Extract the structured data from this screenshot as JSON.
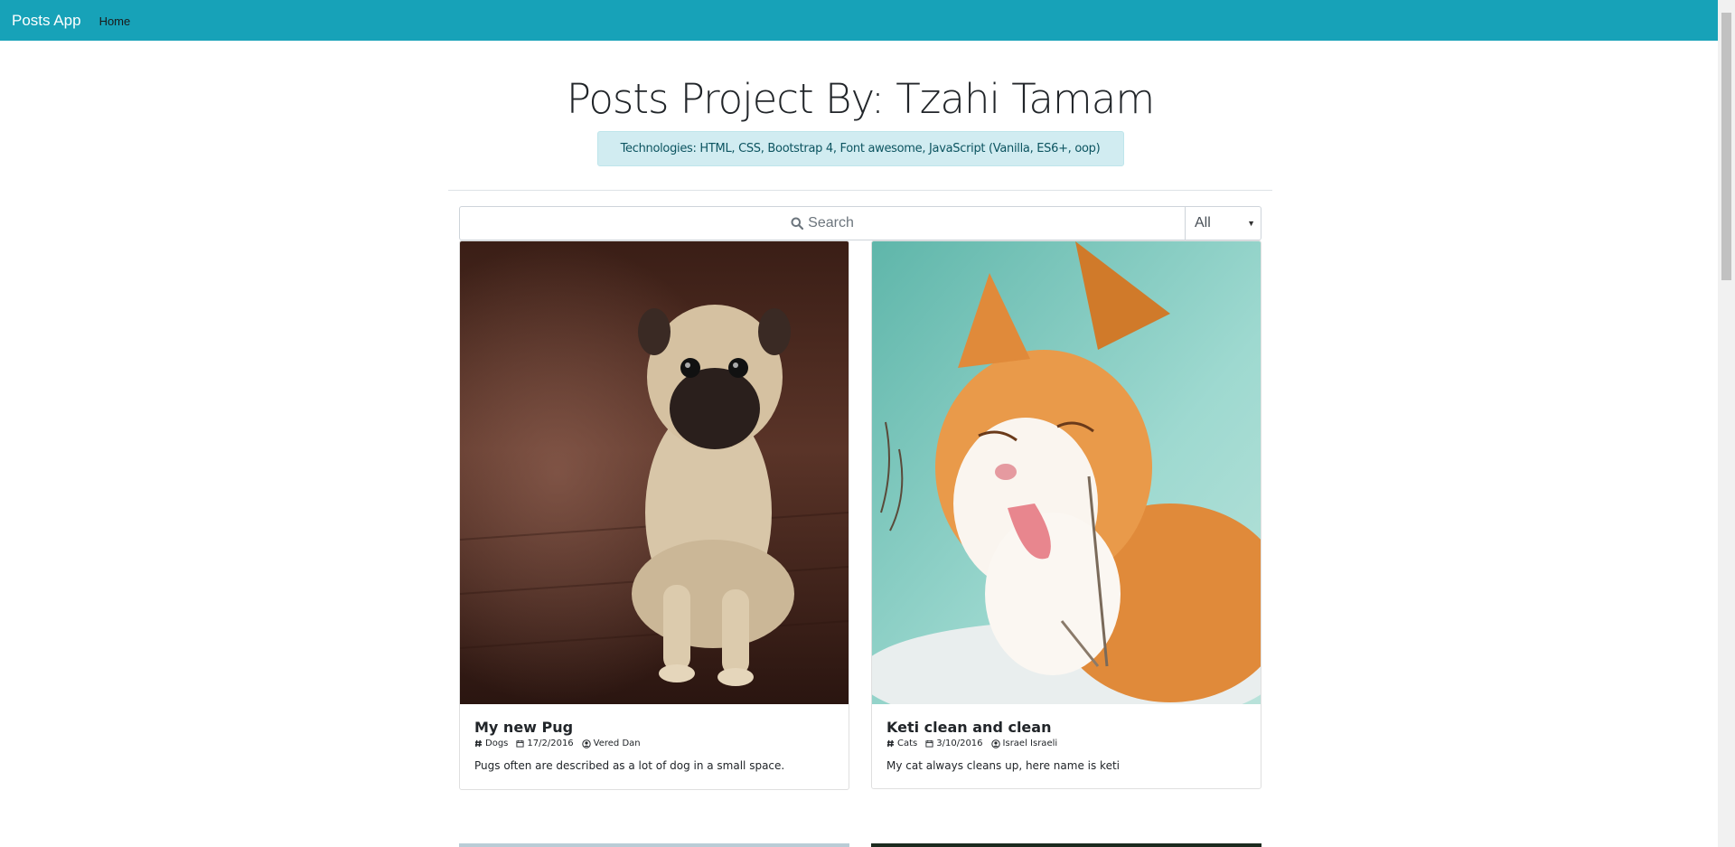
{
  "navbar": {
    "brand": "Posts App",
    "home": "Home"
  },
  "header": {
    "title": "Posts Project By: Tzahi Tamam",
    "technologies": "Technologies: HTML, CSS, Bootstrap 4, Font awesome, JavaScript (Vanilla, ES6+, oop)"
  },
  "search": {
    "placeholder": "Search",
    "filter_value": "All"
  },
  "posts": [
    {
      "title": "My new Pug",
      "category": "Dogs",
      "date": "17/2/2016",
      "author": "Vered Dan",
      "text": "Pugs often are described as a lot of dog in a small space.",
      "image": "pug-photo"
    },
    {
      "title": "Keti clean and clean",
      "category": "Cats",
      "date": "3/10/2016",
      "author": "Israel Israeli",
      "text": "My cat always cleans up, here name is keti",
      "image": "cat-photo"
    }
  ],
  "colors": {
    "navbar": "#17a2b8",
    "badge_bg": "#d1ecf1",
    "badge_text": "#0c5460"
  }
}
